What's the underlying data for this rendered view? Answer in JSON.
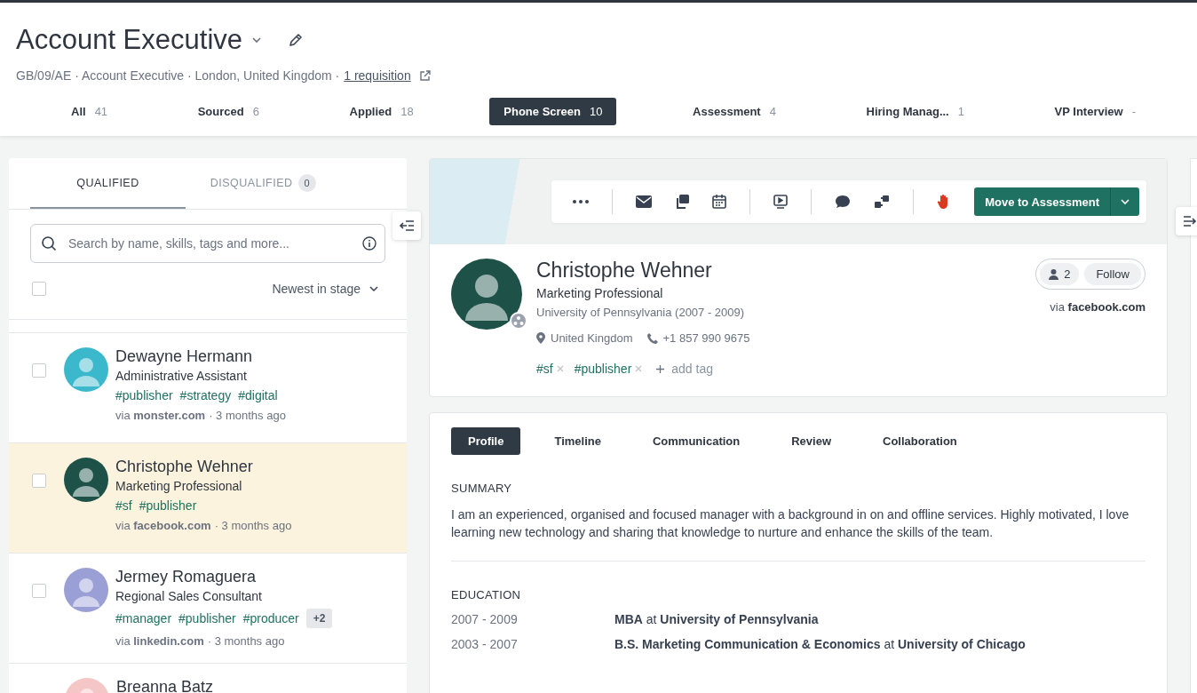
{
  "job": {
    "title": "Account Executive",
    "meta": "GB/09/AE · Account Executive · London, United Kingdom ·",
    "requisition_link": "1 requisition"
  },
  "stages": [
    {
      "label": "All",
      "count": "41",
      "selected": false
    },
    {
      "label": "Sourced",
      "count": "6",
      "selected": false
    },
    {
      "label": "Applied",
      "count": "18",
      "selected": false
    },
    {
      "label": "Phone Screen",
      "count": "10",
      "selected": true
    },
    {
      "label": "Assessment",
      "count": "4",
      "selected": false
    },
    {
      "label": "Hiring Manag...",
      "count": "1",
      "selected": false
    },
    {
      "label": "VP Interview",
      "count": "-",
      "selected": false
    }
  ],
  "list_tabs": [
    {
      "label": "QUALIFIED",
      "selected": true
    },
    {
      "label": "DISQUALIFIED",
      "badge": "0",
      "selected": false
    }
  ],
  "search": {
    "placeholder": "Search by name, skills, tags and more..."
  },
  "sort": {
    "label": "Newest in stage",
    "all_checked": false
  },
  "candidates": [
    {
      "name": "Dewayne Hermann",
      "role": "Administrative Assistant",
      "tags": [
        "#publisher",
        "#strategy",
        "#digital"
      ],
      "source": "via **monster.com**",
      "time": "· 3 months ago",
      "selected": false,
      "checked": false,
      "color": "#3bb8cc"
    },
    {
      "name": "Christophe Wehner",
      "role": "Marketing Professional",
      "tags": [
        "#sf",
        "#publisher"
      ],
      "source": "via **facebook.com**",
      "time": "· 3 months ago",
      "selected": true,
      "checked": false,
      "color": "#1e5248"
    },
    {
      "name": "Jermey Romaguera",
      "role": "Regional Sales Consultant",
      "tags": [
        "#manager",
        "#publisher",
        "#producer"
      ],
      "more": "+2",
      "source": "via **linkedin.com**",
      "time": "· 3 months ago",
      "selected": false,
      "checked": false,
      "color": "#9a9fd6"
    },
    {
      "name": "Breanna Batz",
      "selected": false,
      "color": "#f5c6c6"
    }
  ],
  "actions": {
    "primary": "Move to Assessment"
  },
  "profile": {
    "name": "Christophe Wehner",
    "role": "Marketing Professional",
    "education": "University of Pennsylvania (2007 - 2009)",
    "location": "United Kingdom",
    "phone": "+1 857 990 9675",
    "tags": [
      "#sf",
      "#publisher"
    ],
    "add_tag": "add tag",
    "followers": "2",
    "follow": "Follow",
    "via": "via",
    "source": "facebook.com"
  },
  "profile_tabs": [
    {
      "label": "Profile",
      "selected": true
    },
    {
      "label": "Timeline",
      "selected": false
    },
    {
      "label": "Communication",
      "selected": false
    },
    {
      "label": "Review",
      "selected": false
    },
    {
      "label": "Collaboration",
      "selected": false
    }
  ],
  "summary": {
    "heading": "SUMMARY",
    "text": "I am an experienced, organised and focused manager with a background in on and offline services. Highly motivated, I love learning new technology and sharing that knowledge to nurture and enhance the skills of the team."
  },
  "education": {
    "heading": "EDUCATION",
    "rows": [
      {
        "years": "2007 - 2009",
        "degree": "**MBA** at **University of Pennsylvania**"
      },
      {
        "years": "2003 - 2007",
        "degree": "**B.S. Marketing Communication & Economics** at **University of Chicago**"
      }
    ]
  }
}
